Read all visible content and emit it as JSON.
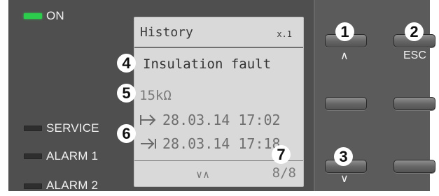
{
  "status_leds": [
    {
      "label": "ON",
      "state": "on",
      "color": "#2ccd4d"
    },
    {
      "label": "SERVICE",
      "state": "off"
    },
    {
      "label": "ALARM 1",
      "state": "off"
    },
    {
      "label": "ALARM 2",
      "state": "off"
    }
  ],
  "display": {
    "title": "History",
    "page_index": "x.1",
    "fault_text": "Insulation fault",
    "resistance": "15kΩ",
    "start_time": "28.03.14  17:02",
    "end_time": "28.03.14  17:18",
    "nav_indicator": "∨∧",
    "record_count": "8/8",
    "start_icon": "fault-start-arrow-icon",
    "end_icon": "fault-end-arrow-icon"
  },
  "buttons": {
    "up_label": "∧",
    "esc_label": "ESC",
    "down_label": "∨"
  },
  "callouts": [
    "1",
    "2",
    "3",
    "4",
    "5",
    "6",
    "7"
  ]
}
